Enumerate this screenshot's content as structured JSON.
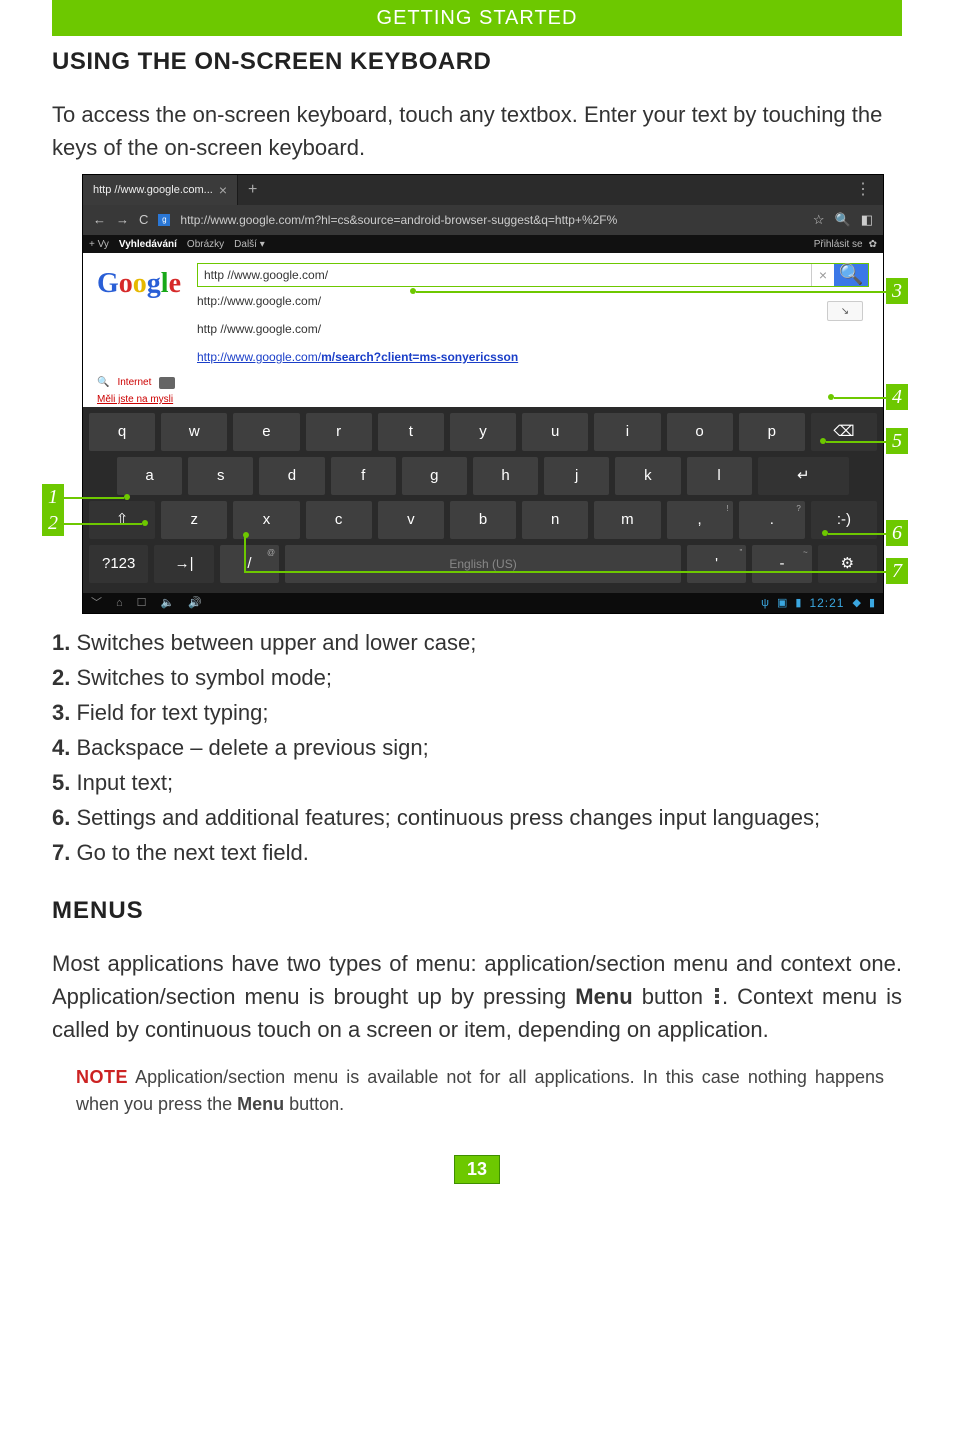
{
  "banner": "GETTING STARTED",
  "heading1": "USING THE ON-SCREEN KEYBOARD",
  "intro": "To access the on-screen keyboard, touch any textbox. Enter your text by touching the keys of the on-screen keyboard.",
  "browser": {
    "tab_title": "http //www.google.com...",
    "url": "http://www.google.com/m?hl=cs&source=android-browser-suggest&q=http+%2F%",
    "subnav": {
      "vy": "+ Vy",
      "search": "Vyhledávání",
      "images": "Obrázky",
      "more": "Další",
      "signin": "Přihlásit se"
    },
    "google": {
      "input": "http //www.google.com/",
      "suggestions": [
        "http://www.google.com/",
        "http //www.google.com/",
        "http://www.google.com/m/search?client=ms-sonyericsson"
      ],
      "internet": "Internet",
      "meli": "Měli jste na mysli"
    }
  },
  "keyboard": {
    "row1": [
      "q",
      "w",
      "e",
      "r",
      "t",
      "y",
      "u",
      "i",
      "o",
      "p"
    ],
    "row2": [
      "a",
      "s",
      "d",
      "f",
      "g",
      "h",
      "j",
      "k",
      "l"
    ],
    "row3": [
      "z",
      "x",
      "c",
      "v",
      "b",
      "n",
      "m",
      ",",
      "."
    ],
    "sym": "?123",
    "slash": "/",
    "slash_sup": "@",
    "space": "English (US)",
    "smile": ":-)",
    "comma_sup": "!",
    "period_sup": "?",
    "apostrophe_sup": "\"",
    "dash_sup": "~"
  },
  "sysbar": {
    "clock": "12:21"
  },
  "callouts": {
    "c1": "1",
    "c2": "2",
    "c3": "3",
    "c4": "4",
    "c5": "5",
    "c6": "6",
    "c7": "7"
  },
  "list": [
    {
      "n": "1.",
      "t": " Switches between upper and lower case;"
    },
    {
      "n": "2.",
      "t": " Switches to symbol mode;"
    },
    {
      "n": "3.",
      "t": " Field for text typing;"
    },
    {
      "n": "4.",
      "t": " Backspace – delete a previous sign;"
    },
    {
      "n": "5.",
      "t": " Input text;"
    },
    {
      "n": "6.",
      "t": " Settings and additional features; continuous press changes input languages;"
    },
    {
      "n": "7.",
      "t": " Go to the next text field."
    }
  ],
  "heading2": "MENUS",
  "menus_p1a": "Most applications have two types of menu: application/section menu and context one. Application/section menu is brought up by pressing ",
  "menus_p1b": "Menu",
  "menus_p1c": " button ",
  "menus_p1d": ". Context menu is called by continuous touch on a screen or item, depending on application.",
  "note_label": "NOTE",
  "note_a": " Application/section menu is available not for all applications. In this case nothing happens when you press the ",
  "note_b": "Menu",
  "note_c": " button.",
  "page_number": "13"
}
